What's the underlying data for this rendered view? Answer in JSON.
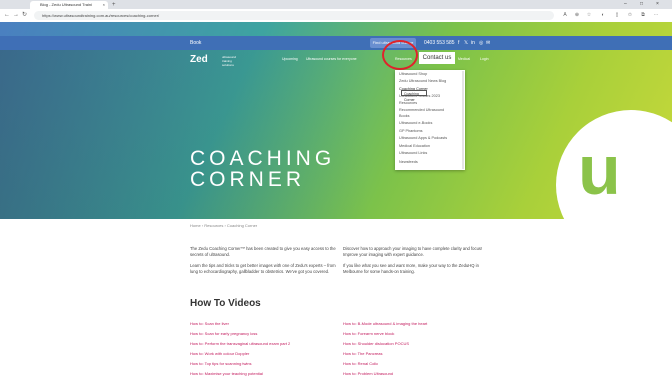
{
  "browser": {
    "tab_title": "Blog - Zedu Ultrasound Traini",
    "tab_close": "×",
    "new_tab": "+",
    "url": "https://www.ultrasoundtraining.com.au/resources/coaching-corner/",
    "win_min": "–",
    "win_max": "□",
    "win_close": "×"
  },
  "topbar": {
    "left_link": "Book",
    "find_button": "Find ultrasound course",
    "phone": "0403 553 585"
  },
  "brand": {
    "logo": "Zed",
    "tagline": "ultrasound training solutions"
  },
  "nav": {
    "items": [
      {
        "label": "Upcoming"
      },
      {
        "label": "Ultrasound courses for everyone"
      },
      {
        "label": "Resources"
      },
      {
        "label": "Medical"
      },
      {
        "label": "Login"
      }
    ],
    "contact_label": "Contact us"
  },
  "dropdown": {
    "items": [
      {
        "label": "Ultrasound Shop"
      },
      {
        "label": "Zedu Ultrasound News Blog"
      },
      {
        "label": "Coaching Corner"
      },
      {
        "label": "Ultrasound Guides 2023"
      },
      {
        "label": "Resources"
      },
      {
        "label": "Recommended Ultrasound"
      },
      {
        "label": "Books"
      },
      {
        "label": "Ultrasound e-Books"
      },
      {
        "label": "GP Phantoms"
      },
      {
        "label": "Ultrasound Apps & Podcasts"
      },
      {
        "label": "Medical Education"
      },
      {
        "label": "Ultrasound Links"
      },
      {
        "label": "Newsfeeds"
      }
    ],
    "tooltip": "Coaching Corner"
  },
  "hero": {
    "title_line1": "COACHING",
    "title_line2": "CORNER",
    "brand_glyph": "u"
  },
  "breadcrumb": {
    "text": "Home  ›  Resources  ›  Coaching Corner"
  },
  "intro": {
    "p1": "The Zedu Coaching Corner™ has been created to give you easy access to the secrets of ultrasound.",
    "p2": "Learn the tips and tricks to get better images with one of Zedu's experts – from lung to echocardiography, gallbladder to obstetrics. We've got you covered.",
    "p3": "Discover how to approach your imaging to have complete clarity and focus! Improve your imaging with expert guidance.",
    "p4": "If you like what you see and want more, make your way to the ZeduHQ in Melbourne for some hands-on training."
  },
  "videos": {
    "heading": "How To Videos",
    "left": [
      {
        "label": "How to: Scan the liver"
      },
      {
        "label": "How to: Scan for early pregnancy loss"
      },
      {
        "label": "How to: Perform the transvaginal ultrasound exam part 2"
      },
      {
        "label": "How to: Work with colour Doppler"
      },
      {
        "label": "How to: Top tips for scanning twins"
      },
      {
        "label": "How to: Maximise your teaching potential"
      }
    ],
    "right": [
      {
        "label": "How to: B-Mode ultrasound & imaging the heart"
      },
      {
        "label": "How to: Forearm nerve block"
      },
      {
        "label": "How to: Shoulder dislocation POCUS"
      },
      {
        "label": "How to: The Pancreas"
      },
      {
        "label": "How to: Renal Colic"
      },
      {
        "label": "How to: Problem Ultrasound"
      }
    ]
  }
}
